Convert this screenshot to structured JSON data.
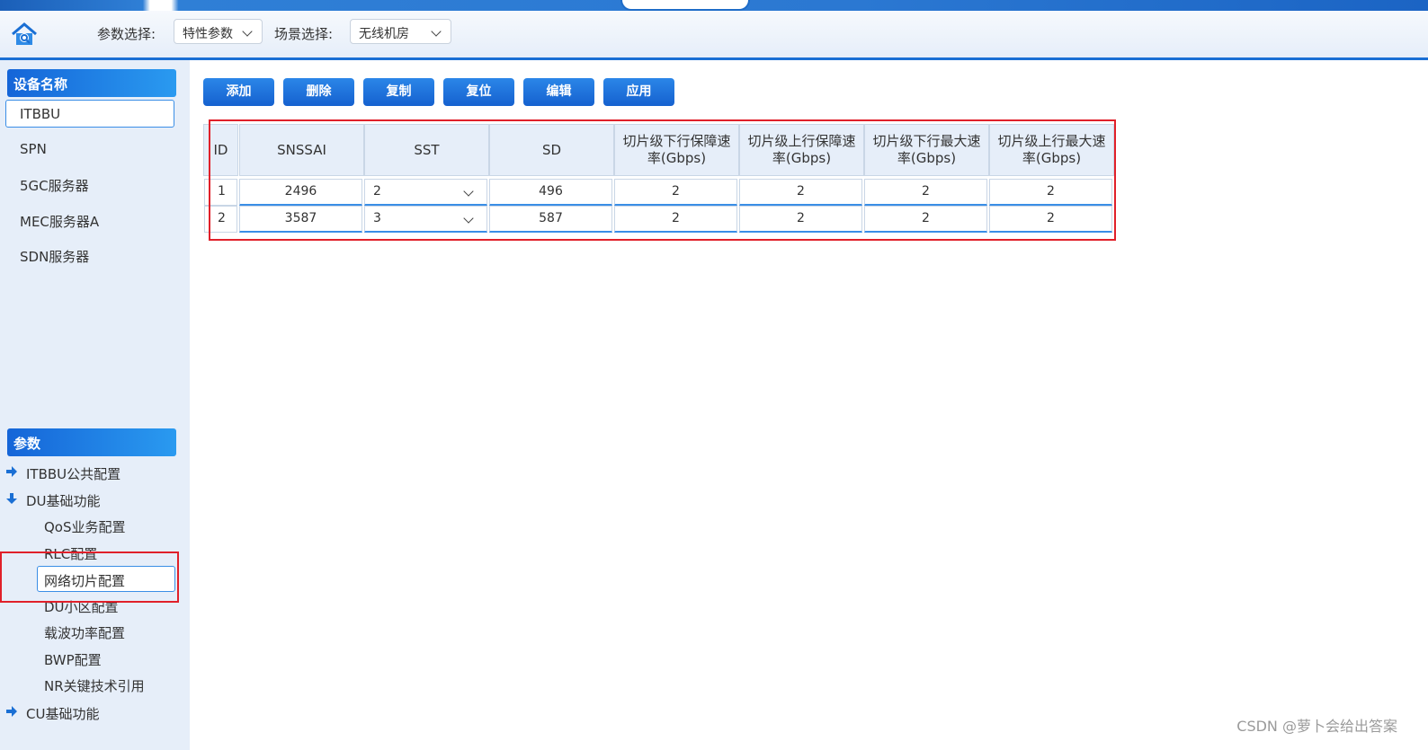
{
  "header": {
    "param_label": "参数选择:",
    "param_value": "特性参数",
    "scene_label": "场景选择:",
    "scene_value": "无线机房"
  },
  "sidebar": {
    "device_title": "设备名称",
    "devices": [
      "ITBBU",
      "SPN",
      "5GC服务器",
      "MEC服务器A",
      "SDN服务器"
    ],
    "params_title": "参数",
    "tree": {
      "itbbu_public": "ITBBU公共配置",
      "du_basic": "DU基础功能",
      "du_children": [
        "QoS业务配置",
        "RLC配置",
        "网络切片配置",
        "DU小区配置",
        "载波功率配置",
        "BWP配置",
        "NR关键技术引用"
      ],
      "cu_basic": "CU基础功能"
    }
  },
  "toolbar": {
    "add": "添加",
    "delete": "删除",
    "copy": "复制",
    "reset": "复位",
    "edit": "编辑",
    "apply": "应用"
  },
  "table": {
    "headers": {
      "id": "ID",
      "snssai": "SNSSAI",
      "sst": "SST",
      "sd": "SD",
      "dl_guar_1": "切片级下行保障速",
      "dl_guar_2": "率(Gbps)",
      "ul_guar_1": "切片级上行保障速",
      "ul_guar_2": "率(Gbps)",
      "dl_max_1": "切片级下行最大速",
      "dl_max_2": "率(Gbps)",
      "ul_max_1": "切片级上行最大速",
      "ul_max_2": "率(Gbps)"
    },
    "rows": [
      {
        "id": "1",
        "snssai": "2496",
        "sst": "2",
        "sd": "496",
        "dl_guar": "2",
        "ul_guar": "2",
        "dl_max": "2",
        "ul_max": "2"
      },
      {
        "id": "2",
        "snssai": "3587",
        "sst": "3",
        "sd": "587",
        "dl_guar": "2",
        "ul_guar": "2",
        "dl_max": "2",
        "ul_max": "2"
      }
    ]
  },
  "watermark": "CSDN @萝卜会给出答案",
  "colors": {
    "accent": "#1a6fd4",
    "sidebar_bg": "#e6eef9",
    "highlight": "#e0202a"
  }
}
